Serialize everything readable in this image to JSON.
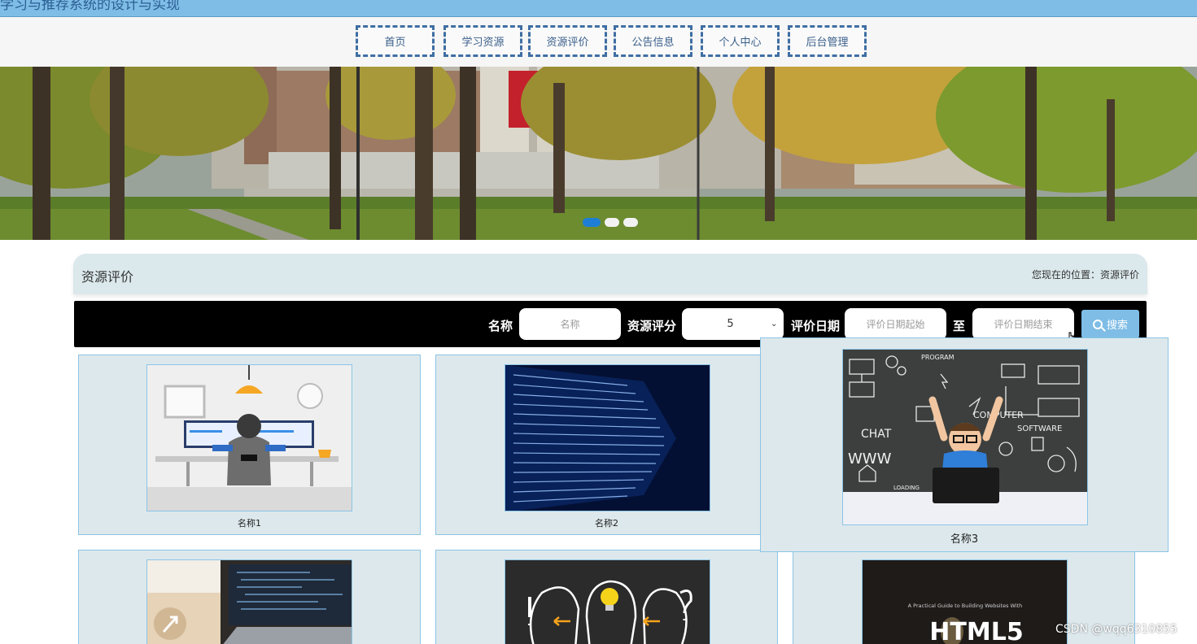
{
  "site": {
    "title": "学习与推荐系统的设计与实现"
  },
  "nav": {
    "items": [
      {
        "label": "首页"
      },
      {
        "label": "学习资源"
      },
      {
        "label": "资源评价"
      },
      {
        "label": "公告信息"
      },
      {
        "label": "个人中心"
      },
      {
        "label": "后台管理"
      }
    ]
  },
  "banner": {
    "slide_count": 3,
    "active_slide": 1
  },
  "section": {
    "title": "资源评价",
    "breadcrumb_prefix": "您现在的位置：",
    "breadcrumb_current": "资源评价"
  },
  "search": {
    "name_label": "名称",
    "name_placeholder": "名称",
    "score_label": "资源评分",
    "score_value": "5",
    "date_label": "评价日期",
    "date_start_placeholder": "评价日期起始",
    "date_separator": "至",
    "date_end_placeholder": "评价日期结束",
    "button_label": "搜索"
  },
  "cards": [
    {
      "name": "名称1",
      "image": "office-desk-illustration"
    },
    {
      "name": "名称2",
      "image": "code-wall"
    },
    {
      "name": "名称3",
      "image": "kid-chalkboard-computer"
    },
    {
      "name": "",
      "image": "laptop-code"
    },
    {
      "name": "",
      "image": "lightbulb-heads"
    },
    {
      "name": "",
      "image": "html5-book"
    }
  ],
  "card_images": {
    "chalkboard_words": [
      "PROGRAM",
      "CHAT",
      "WWW",
      "COMPUTER",
      "SOFTWARE",
      "LOADING"
    ],
    "book_title": "HTML5",
    "book_subtitle": "A Practical Guide to Building Websites With"
  },
  "colors": {
    "accent": "#7fbde6",
    "nav_border": "#3f6ea3",
    "card_bg": "#dde8ec",
    "card_border": "#8cc4e6"
  },
  "watermark": "CSDN @wqq6310855"
}
